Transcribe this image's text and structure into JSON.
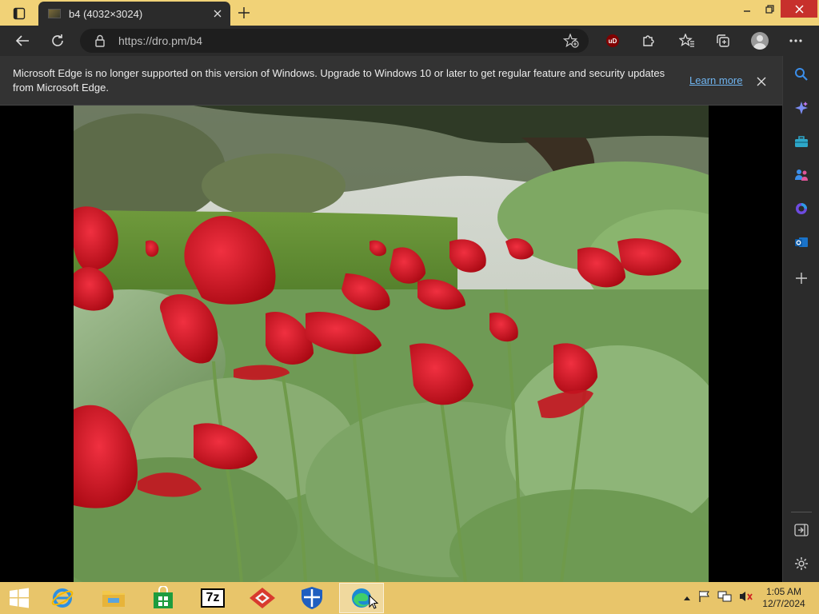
{
  "browser": {
    "tab_title": "b4 (4032×3024)",
    "url": "https://dro.pm/b4",
    "ublock_label": "uD"
  },
  "infobar": {
    "message": "Microsoft Edge is no longer supported on this version of Windows. Upgrade to Windows 10 or later to get regular feature and security updates from Microsoft Edge.",
    "link": "Learn more"
  },
  "taskbar": {
    "apps": [
      "internet-explorer",
      "file-explorer",
      "store",
      "7-zip",
      "gitkraken",
      "windows-defender",
      "microsoft-edge"
    ],
    "sevenzip_label": "7z",
    "time": "1:05 AM",
    "date": "12/7/2024"
  },
  "colors": {
    "titlebar": "#f1d277",
    "toolbar": "#2b2b2b",
    "taskbar": "#e8c56a",
    "link": "#6fb4f0"
  }
}
